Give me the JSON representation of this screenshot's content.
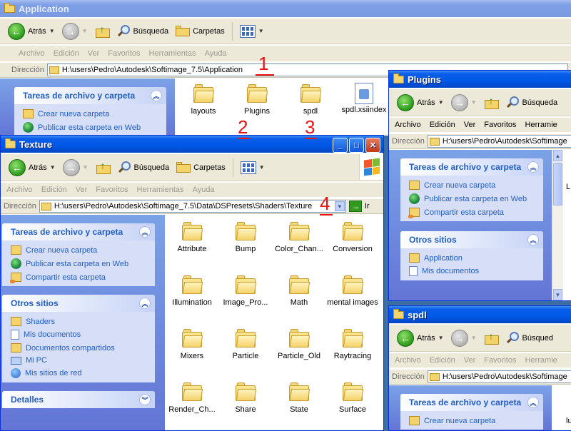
{
  "windows": {
    "application": {
      "title": "Application",
      "toolbar": {
        "back": "Atrás",
        "search": "Búsqueda",
        "folders": "Carpetas"
      },
      "menu": [
        "Archivo",
        "Edición",
        "Ver",
        "Favoritos",
        "Herramientas",
        "Ayuda"
      ],
      "address_label": "Dirección",
      "address": "H:\\users\\Pedro\\Autodesk\\Softimage_7.5\\Application",
      "tasks_title": "Tareas de archivo y carpeta",
      "tasks": [
        "Crear nueva carpeta",
        "Publicar esta carpeta en Web"
      ],
      "files": [
        "layouts",
        "Plugins",
        "spdl",
        "spdl.xsiindex"
      ]
    },
    "texture": {
      "title": "Texture",
      "toolbar": {
        "back": "Atrás",
        "search": "Búsqueda",
        "folders": "Carpetas"
      },
      "menu": [
        "Archivo",
        "Edición",
        "Ver",
        "Favoritos",
        "Herramientas",
        "Ayuda"
      ],
      "address_label": "Dirección",
      "address": "H:\\users\\Pedro\\Autodesk\\Softimage_7.5\\Data\\DSPresets\\Shaders\\Texture",
      "go_label": "Ir",
      "tasks_title": "Tareas de archivo y carpeta",
      "tasks": [
        "Crear nueva carpeta",
        "Publicar esta carpeta en Web",
        "Compartir esta carpeta"
      ],
      "other_title": "Otros sitios",
      "other": [
        "Shaders",
        "Mis documentos",
        "Documentos compartidos",
        "Mi PC",
        "Mis sitios de red"
      ],
      "details_title": "Detalles",
      "files": [
        "Attribute",
        "Bump",
        "Color_Chan...",
        "Conversion",
        "Illumination",
        "Image_Pro...",
        "Math",
        "mental images",
        "Mixers",
        "Particle",
        "Particle_Old",
        "Raytracing",
        "Render_Ch...",
        "Share",
        "State",
        "Surface"
      ]
    },
    "plugins": {
      "title": "Plugins",
      "toolbar": {
        "back": "Atrás",
        "search": "Búsqueda"
      },
      "menu": [
        "Archivo",
        "Edición",
        "Ver",
        "Favoritos",
        "Herramie"
      ],
      "address_label": "Dirección",
      "address": "H:\\users\\Pedro\\Autodesk\\Softimage",
      "tasks_title": "Tareas de archivo y carpeta",
      "tasks": [
        "Crear nueva carpeta",
        "Publicar esta carpeta en Web",
        "Compartir esta carpeta"
      ],
      "other_title": "Otros sitios",
      "other": [
        "Application",
        "Mis documentos"
      ],
      "file_label": "L"
    },
    "spdl": {
      "title": "spdl",
      "toolbar": {
        "back": "Atrás",
        "search": "Búsqued"
      },
      "menu": [
        "Archivo",
        "Edición",
        "Ver",
        "Favoritos",
        "Herramie"
      ],
      "address_label": "Dirección",
      "address": "H:\\users\\Pedro\\Autodesk\\Softimage",
      "tasks_title": "Tareas de archivo y carpeta",
      "tasks": [
        "Crear nueva carpeta"
      ],
      "file_label": "lu"
    }
  },
  "annotations": [
    "1",
    "2",
    "3",
    "4"
  ],
  "colors": {
    "annotation": "#ee1111",
    "titlebar": "#0058e6",
    "link": "#215dc6"
  }
}
